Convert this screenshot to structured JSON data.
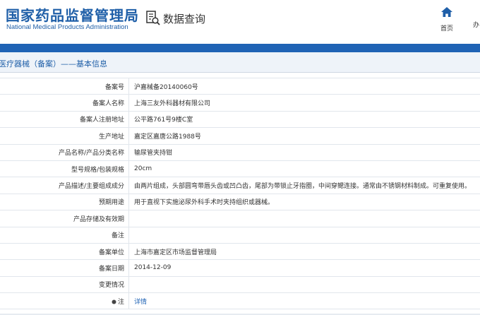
{
  "header": {
    "logo_cn": "国家药品监督管理局",
    "logo_en": "National Medical Products Administration",
    "query_label": "数据查询",
    "nav_home": "首页",
    "nav_more": "办"
  },
  "breadcrumb": "医疗器械（备案）——基本信息",
  "rows": [
    {
      "key": "备案号",
      "value": "沪嘉械备20140060号"
    },
    {
      "key": "备案人名称",
      "value": "上海三友外科器材有限公司"
    },
    {
      "key": "备案人注册地址",
      "value": "公平路761号9楼C室"
    },
    {
      "key": "生产地址",
      "value": "嘉定区嘉唐公路1988号"
    },
    {
      "key": "产品名称/产品分类名称",
      "value": "输尿管夹持钳"
    },
    {
      "key": "型号规格/包装规格",
      "value": "20cm"
    },
    {
      "key": "产品描述/主要组成成分",
      "value": "由两片组成，头部圆弯带唇头齿或凹凸齿，尾部为带锁止牙指圈，中间穿鳃连接。通常由不锈钢材料制成。可重复使用。"
    },
    {
      "key": "预期用途",
      "value": "用于直视下实施泌尿外科手术时夹持组织或器械。"
    },
    {
      "key": "产品存储及有效期",
      "value": ""
    },
    {
      "key": "备注",
      "value": ""
    },
    {
      "key": "备案单位",
      "value": "上海市嘉定区市场监督管理局"
    },
    {
      "key": "备案日期",
      "value": "2014-12-09"
    },
    {
      "key": "变更情况",
      "value": ""
    },
    {
      "key": "注",
      "value": "详情"
    }
  ],
  "colors": {
    "brand": "#1f5fa8",
    "bar": "#1f63b5"
  }
}
